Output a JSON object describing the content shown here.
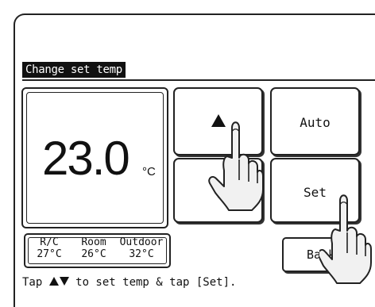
{
  "screen": {
    "title": "Change set temp"
  },
  "temperature": {
    "value": "23.0",
    "unit": "°C"
  },
  "buttons": {
    "up_icon": "triangle-up",
    "down_icon": "triangle-down",
    "auto_label": "Auto",
    "set_label": "Set",
    "back_label": "Back"
  },
  "readout": {
    "rc_label": "R/C",
    "rc_value": "27°C",
    "room_label": "Room",
    "room_value": "26°C",
    "outdoor_label": "Outdoor",
    "outdoor_value": "32°C"
  },
  "instruction": {
    "prefix": "Tap ",
    "suffix": " to set temp & tap [Set]."
  },
  "colors": {
    "foreground": "#111111",
    "background": "#ffffff"
  }
}
